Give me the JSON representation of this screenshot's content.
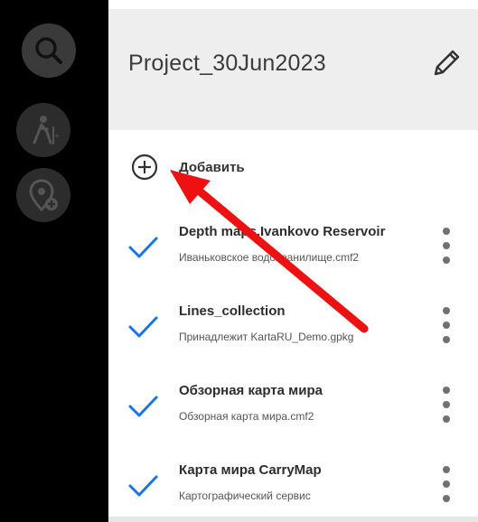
{
  "sidebar": {
    "buttons": [
      {
        "icon": "search-icon"
      },
      {
        "icon": "hiking-person-icon"
      },
      {
        "icon": "add-location-icon"
      }
    ]
  },
  "project": {
    "title": "Project_30Jun2023",
    "edit_icon": "pencil-icon"
  },
  "add": {
    "label": "Добавить",
    "icon": "plus-circle-icon"
  },
  "layers": [
    {
      "name": "Depth maps.Ivankovo Reservoir",
      "source": "Иваньковское водохранилище.cmf2",
      "checked": true
    },
    {
      "name": "Lines_collection",
      "source": "Принадлежит KartaRU_Demo.gpkg",
      "checked": true
    },
    {
      "name": "Обзорная карта мира",
      "source": "Обзорная карта мира.cmf2",
      "checked": true
    },
    {
      "name": "Карта мира CarryMap",
      "source": "Картографический сервис",
      "checked": true
    }
  ],
  "colors": {
    "check": "#1a73e8",
    "annotation_arrow": "#ee1111",
    "header_bg": "#eeeeee"
  }
}
